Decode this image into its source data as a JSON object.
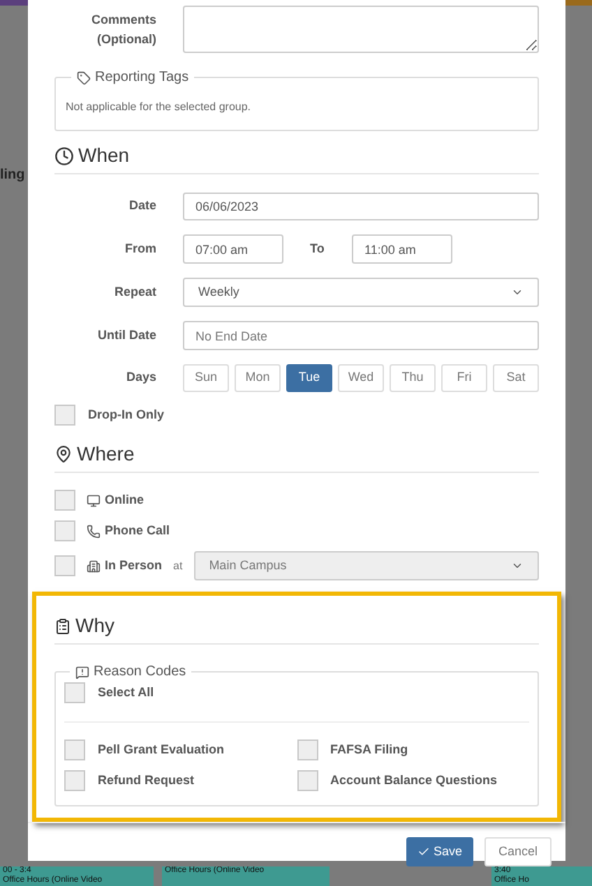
{
  "background": {
    "side_label": "ling",
    "events": [
      {
        "time": "00 - 3:4",
        "title": "Office Hours (Online Video"
      },
      {
        "title": "Office Hours (Online Video"
      },
      {
        "time": "3:40",
        "title": "Office Ho"
      }
    ]
  },
  "comments": {
    "label": "Comments (Optional)"
  },
  "reporting_tags": {
    "title": "Reporting Tags",
    "note": "Not applicable for the selected group."
  },
  "when": {
    "title": "When",
    "date": {
      "label": "Date",
      "value": "06/06/2023"
    },
    "from": {
      "label": "From",
      "value": "07:00 am"
    },
    "to": {
      "label": "To",
      "value": "11:00 am"
    },
    "repeat": {
      "label": "Repeat",
      "value": "Weekly"
    },
    "until": {
      "label": "Until Date",
      "placeholder": "No End Date"
    },
    "days_label": "Days",
    "days": [
      {
        "label": "Sun",
        "selected": false
      },
      {
        "label": "Mon",
        "selected": false
      },
      {
        "label": "Tue",
        "selected": true
      },
      {
        "label": "Wed",
        "selected": false
      },
      {
        "label": "Thu",
        "selected": false
      },
      {
        "label": "Fri",
        "selected": false
      },
      {
        "label": "Sat",
        "selected": false
      }
    ],
    "drop_in": {
      "label": "Drop-In Only",
      "checked": false
    }
  },
  "where": {
    "title": "Where",
    "options": [
      {
        "kind": "online",
        "label": "Online",
        "checked": false
      },
      {
        "kind": "phone",
        "label": "Phone Call",
        "checked": false
      },
      {
        "kind": "in_person",
        "label": "In Person",
        "checked": false,
        "at": "at",
        "location": "Main Campus"
      }
    ]
  },
  "why": {
    "title": "Why",
    "legend": "Reason Codes",
    "select_all": {
      "label": "Select All",
      "checked": false
    },
    "codes": [
      {
        "label": "Pell Grant Evaluation",
        "checked": false
      },
      {
        "label": "FAFSA Filing",
        "checked": false
      },
      {
        "label": "Refund Request",
        "checked": false
      },
      {
        "label": "Account Balance Questions",
        "checked": false
      }
    ]
  },
  "buttons": {
    "save": "Save",
    "cancel": "Cancel"
  }
}
